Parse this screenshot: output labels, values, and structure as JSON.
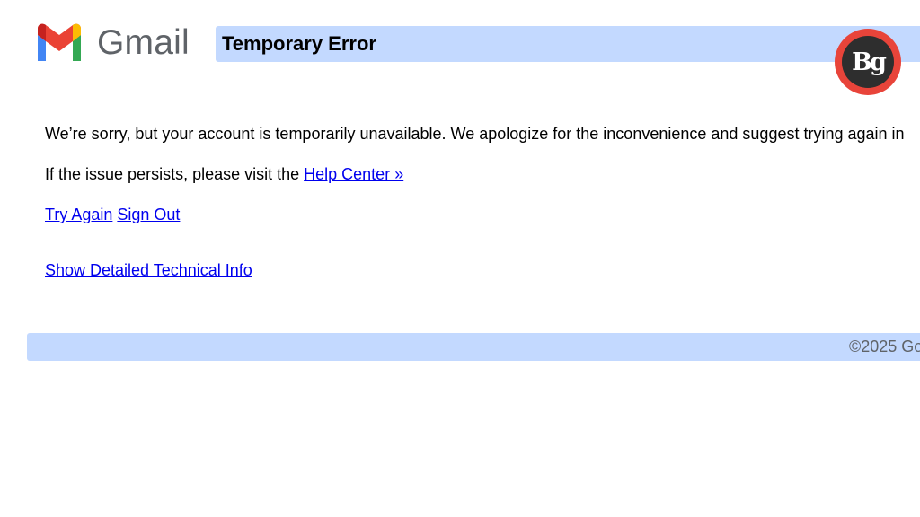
{
  "header": {
    "logo_text": "Gmail",
    "title": "Temporary Error",
    "badge_text": "Bg"
  },
  "message": {
    "line1": "We’re sorry, but your account is temporarily unavailable. We apologize for the inconvenience and suggest trying again in",
    "line2_prefix": "If the issue persists, please visit the ",
    "help_link": "Help Center »"
  },
  "actions": {
    "try_again": "Try Again",
    "sign_out": "Sign Out",
    "technical_info": "Show Detailed Technical Info"
  },
  "footer": {
    "copyright": "©2025 Go"
  },
  "colors": {
    "bar_background": "#c3d9ff",
    "link": "#0000ee",
    "badge_ring": "#e8443a",
    "badge_fill": "#2e2e2e"
  },
  "icons": {
    "logo": "gmail-m-icon"
  }
}
